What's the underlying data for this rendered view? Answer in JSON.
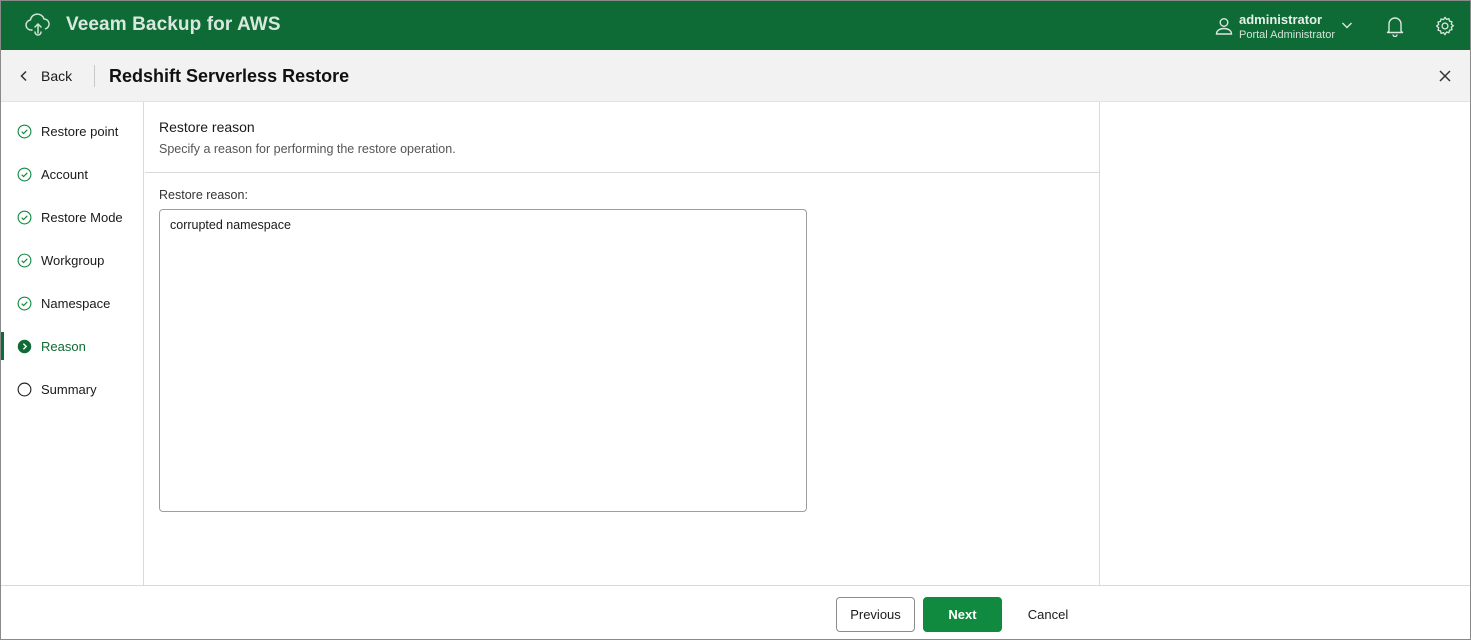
{
  "app": {
    "title": "Veeam Backup for AWS",
    "brand_color": "#0f6b35",
    "logo_icon": "cloud-sync-icon"
  },
  "user": {
    "name": "administrator",
    "role": "Portal Administrator"
  },
  "header": {
    "back_label": "Back",
    "page_title": "Redshift Serverless Restore"
  },
  "steps": [
    {
      "label": "Restore point",
      "status": "done"
    },
    {
      "label": "Account",
      "status": "done"
    },
    {
      "label": "Restore Mode",
      "status": "done"
    },
    {
      "label": "Workgroup",
      "status": "done"
    },
    {
      "label": "Namespace",
      "status": "done"
    },
    {
      "label": "Reason",
      "status": "current"
    },
    {
      "label": "Summary",
      "status": "pending"
    }
  ],
  "main": {
    "section_title": "Restore reason",
    "section_subtitle": "Specify a reason for performing the restore operation.",
    "field_label": "Restore reason:",
    "reason_value": "corrupted namespace"
  },
  "footer": {
    "previous_label": "Previous",
    "next_label": "Next",
    "cancel_label": "Cancel"
  }
}
